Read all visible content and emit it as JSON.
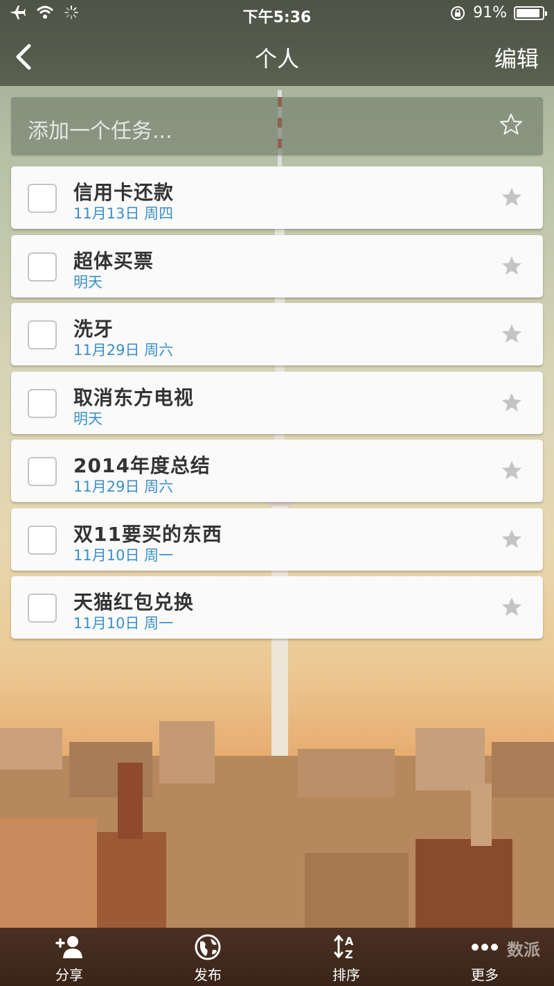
{
  "status_bar": {
    "time": "下午5:36",
    "battery": "91%",
    "battery_level": 0.91
  },
  "nav": {
    "title": "个人",
    "edit_label": "编辑"
  },
  "add_task": {
    "placeholder": "添加一个任务..."
  },
  "tasks": [
    {
      "name": "信用卡还款",
      "due": "11月13日 周四"
    },
    {
      "name": "超体买票",
      "due": "明天"
    },
    {
      "name": "洗牙",
      "due": "11月29日 周六"
    },
    {
      "name": "取消东方电视",
      "due": "明天"
    },
    {
      "name": "2014年度总结",
      "due": "11月29日 周六"
    },
    {
      "name": "双11要买的东西",
      "due": "11月10日 周一"
    },
    {
      "name": "天猫红包兑换",
      "due": "11月10日 周一"
    }
  ],
  "bottom_tabs": [
    {
      "label": "分享",
      "icon": "add-person-icon"
    },
    {
      "label": "发布",
      "icon": "globe-icon"
    },
    {
      "label": "排序",
      "icon": "sort-az-icon"
    },
    {
      "label": "更多",
      "icon": "more-dots-icon"
    }
  ],
  "watermark": "数派",
  "colors": {
    "due_date": "#3a8fc7",
    "top_bar": "#555b4b",
    "bottom_bar": "#41291d"
  }
}
